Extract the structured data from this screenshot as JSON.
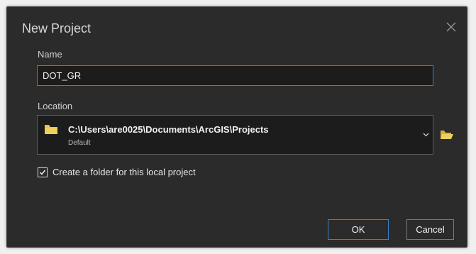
{
  "dialog": {
    "title": "New Project",
    "close_icon": "close-icon"
  },
  "name": {
    "label": "Name",
    "value": "DOT_GR"
  },
  "location": {
    "label": "Location",
    "path": "C:\\Users\\are0025\\Documents\\ArcGIS\\Projects",
    "subtitle": "Default",
    "folder_icon": "folder-icon",
    "dropdown_icon": "chevron-down-icon",
    "browse_icon": "folder-open-icon"
  },
  "create_folder": {
    "label": "Create a folder for this local project",
    "checked": true
  },
  "buttons": {
    "ok": "OK",
    "cancel": "Cancel"
  },
  "colors": {
    "dialog_bg": "#2b2b2b",
    "input_bg": "#1c1c1c",
    "accent": "#3a82c8",
    "folder": "#e8c34a"
  }
}
